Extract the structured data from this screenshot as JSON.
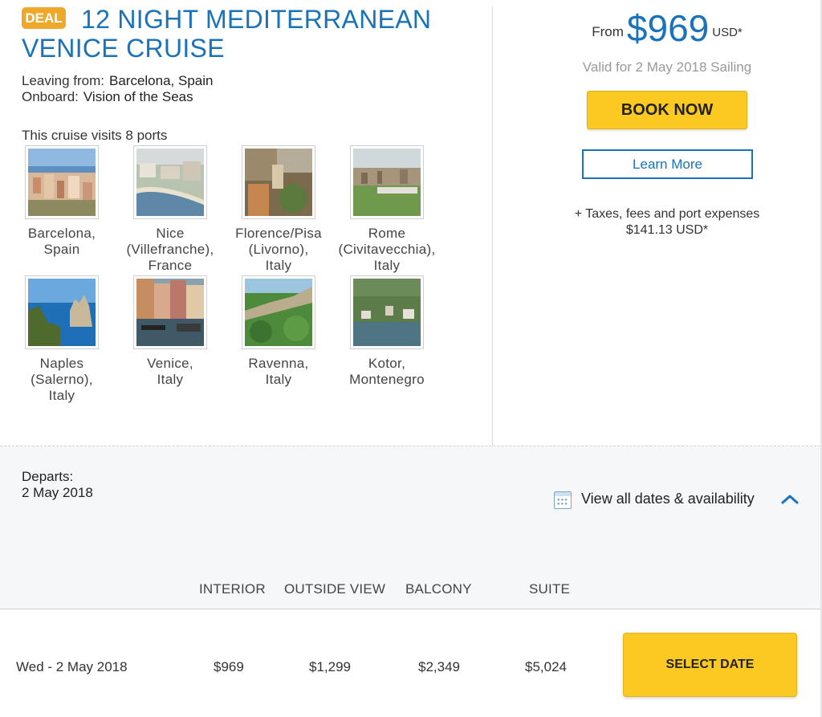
{
  "cruise": {
    "deal_badge": "DEAL",
    "title": "12 NIGHT MEDITERRANEAN VENICE CRUISE",
    "leaving_label": "Leaving from:",
    "leaving_value": "Barcelona, Spain",
    "onboard_label": "Onboard:",
    "onboard_value": "Vision of the Seas",
    "visits_text": "This cruise visits 8 ports"
  },
  "ports": [
    {
      "name": "Barcelona,\nSpain"
    },
    {
      "name": "Nice\n(Villefranche),\nFrance"
    },
    {
      "name": "Florence/Pisa\n(Livorno),\nItaly"
    },
    {
      "name": "Rome\n(Civitavecchia),\nItaly"
    },
    {
      "name": "Naples\n(Salerno),\nItaly"
    },
    {
      "name": "Venice,\nItaly"
    },
    {
      "name": "Ravenna,\nItaly"
    },
    {
      "name": "Kotor,\nMontenegro"
    }
  ],
  "pricing": {
    "from_label": "From",
    "price": "$969",
    "currency": "USD*",
    "valid_text": "Valid for 2 May 2018 Sailing",
    "book_now": "BOOK NOW",
    "learn_more": "Learn More",
    "taxes_line1": "+ Taxes, fees and port expenses",
    "taxes_line2": "$141.13 USD*"
  },
  "departures": {
    "departs_label": "Departs:",
    "departs_date": "2 May 2018",
    "view_all": "View all dates & availability",
    "columns": [
      "INTERIOR",
      "OUTSIDE VIEW",
      "BALCONY",
      "SUITE"
    ],
    "rows": [
      {
        "date": "Wed - 2 May 2018",
        "interior": "$969",
        "outside": "$1,299",
        "balcony": "$2,349",
        "suite": "$5,024",
        "action": "SELECT DATE"
      }
    ]
  },
  "colors": {
    "brand_blue": "#1a73b8",
    "deal_orange": "#f0a82a",
    "button_yellow": "#fcc822"
  },
  "icons": [
    "calendar-icon",
    "chevron-up-icon"
  ]
}
